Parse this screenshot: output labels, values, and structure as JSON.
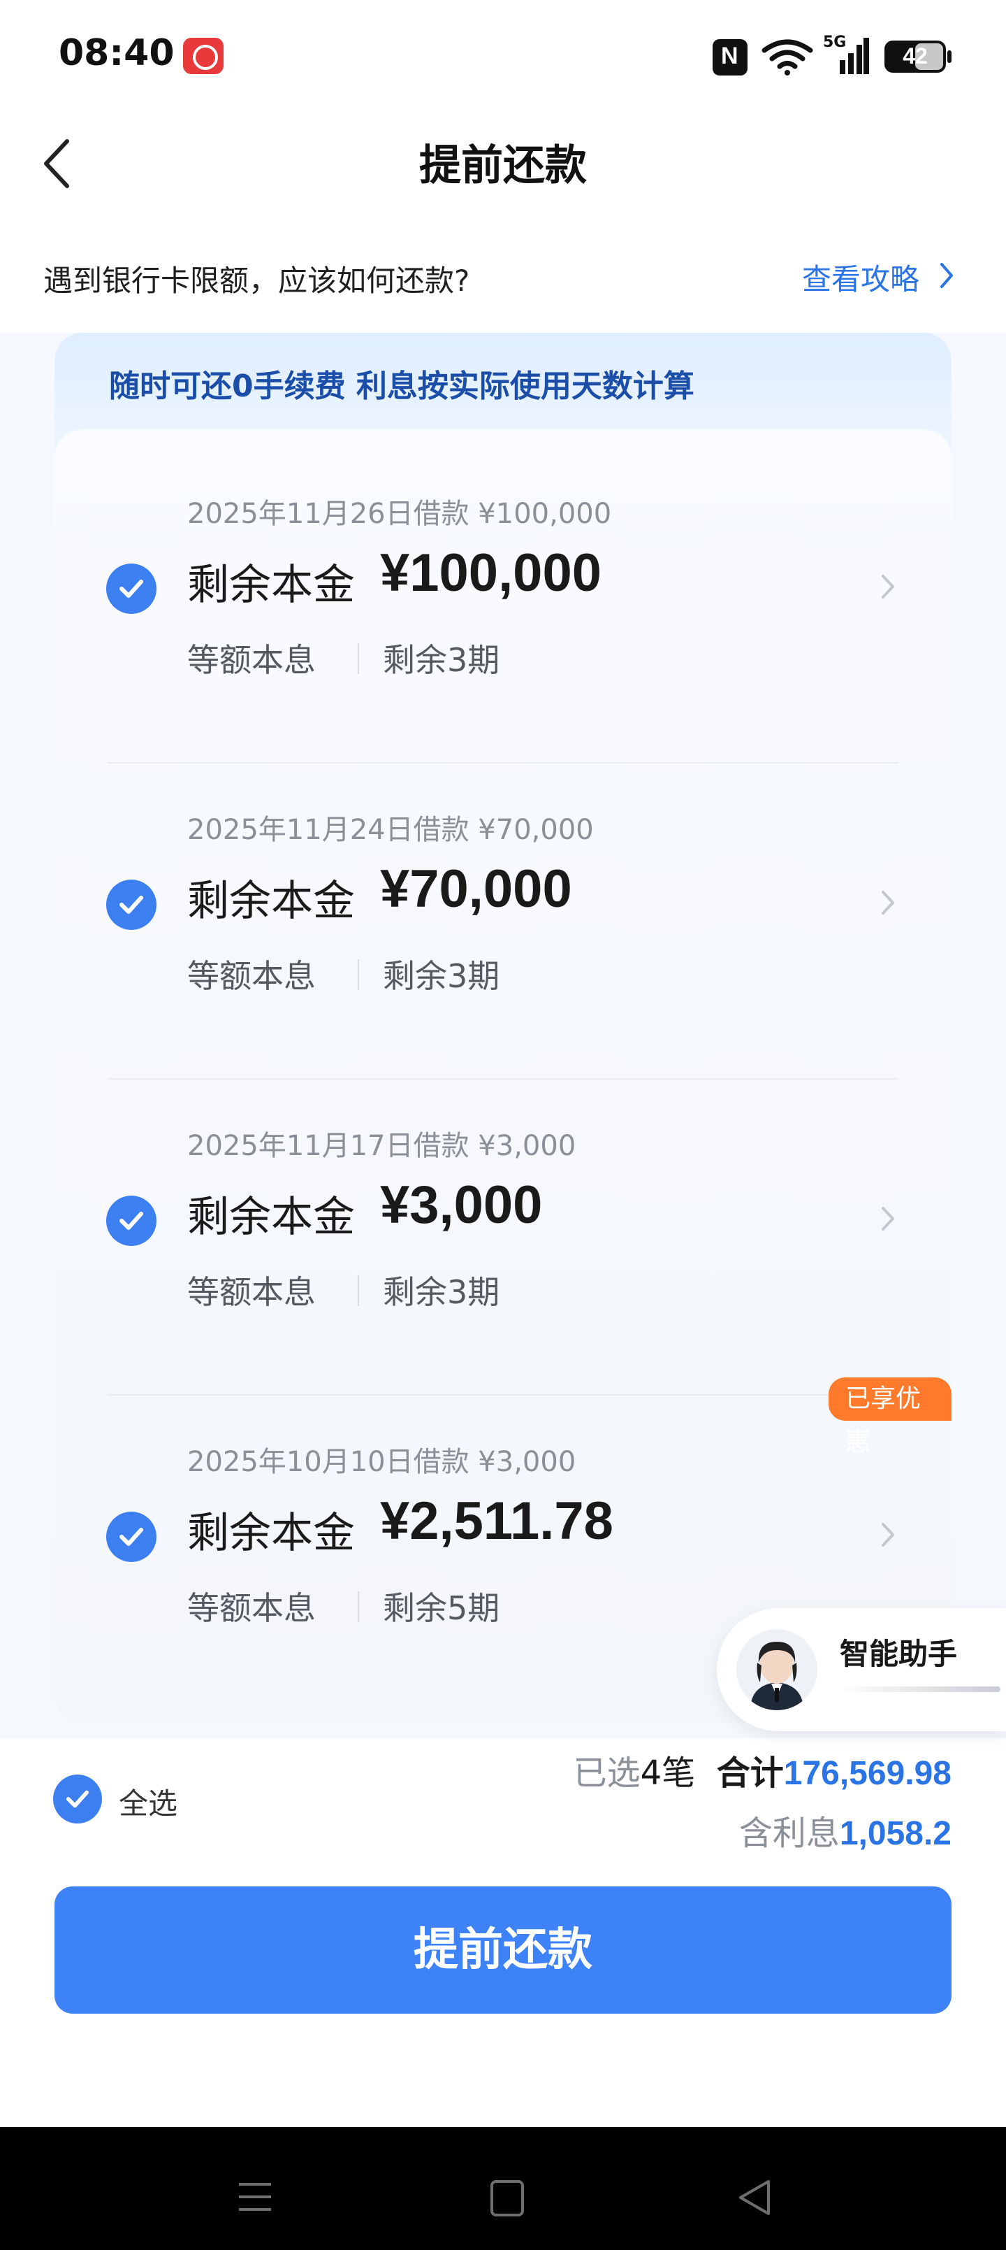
{
  "status_bar": {
    "time": "08:40",
    "app_icon": "pinduoduo-icon",
    "network": "5G",
    "battery": "42",
    "icons": [
      "nfc-icon",
      "wifi-icon",
      "signal-icon",
      "battery-icon"
    ]
  },
  "nav": {
    "title": "提前还款",
    "back_icon": "back-arrow-icon"
  },
  "notice": {
    "text": "遇到银行卡限额，应该如何还款?",
    "link": "查看攻略"
  },
  "banner": {
    "text": "随时可还0手续费 利息按实际使用天数计算"
  },
  "loans": [
    {
      "date": "2025年11月26日借款 ¥100,000",
      "label": "剩余本金",
      "amount": "¥100,000",
      "type": "等额本息",
      "remaining": "剩余3期",
      "checked": true
    },
    {
      "date": "2025年11月24日借款 ¥70,000",
      "label": "剩余本金",
      "amount": "¥70,000",
      "type": "等额本息",
      "remaining": "剩余3期",
      "checked": true
    },
    {
      "date": "2025年11月17日借款 ¥3,000",
      "label": "剩余本金",
      "amount": "¥3,000",
      "type": "等额本息",
      "remaining": "剩余3期",
      "checked": true
    },
    {
      "date": "2025年10月10日借款 ¥3,000",
      "label": "剩余本金",
      "amount": "¥2,511.78",
      "type": "等额本息",
      "remaining": "剩余5期",
      "checked": true,
      "badge": "已享优惠"
    }
  ],
  "assistant": {
    "label": "智能助手"
  },
  "footer": {
    "select_all": "全选",
    "selected_prefix": "已选",
    "selected_count": "4",
    "selected_suffix": "笔",
    "total_label": "合计",
    "total_value": "176,569.98",
    "interest_label": "含利息",
    "interest_value": "1,058.2",
    "submit": "提前还款"
  },
  "colors": {
    "accent": "#3d82f6",
    "link": "#2a74e6",
    "badge": "#ff7a2b",
    "banner_text": "#1a4ea8"
  }
}
